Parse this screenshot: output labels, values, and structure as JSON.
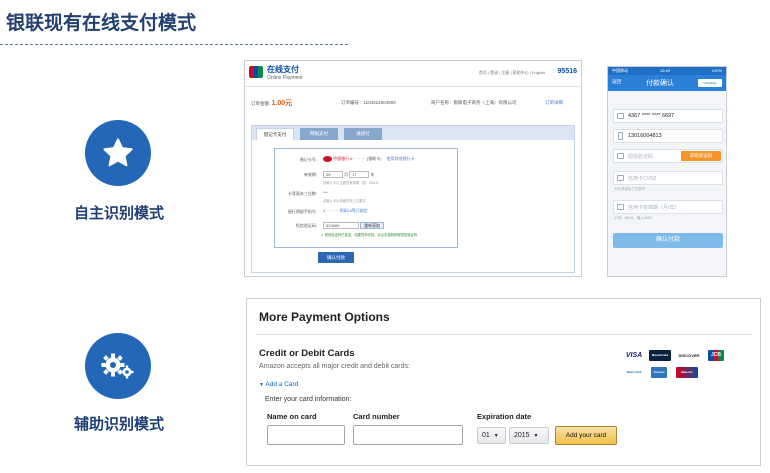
{
  "slide": {
    "title": "银联现有在线支付模式",
    "mode1_label": "自主识别模式",
    "mode2_label": "辅助识别模式"
  },
  "colors": {
    "title": "#24406e",
    "icon_blue": "#2467b6",
    "unionpay_blue": "#0a4ea2",
    "amazon_button": "#f0c14b"
  },
  "icons": {
    "mode1": "star-icon",
    "mode2": "gears-icon"
  },
  "desktop": {
    "brand": "在线支付",
    "brand_sub": "Online Payment",
    "top_links": "首页 | 登录 | 注册 | 帮助中心 | English",
    "hotline": "95516",
    "order_amount_label": "订单金额:",
    "order_amount": "1.00元",
    "order_no": "订单编号：1104221004900",
    "merchant": "商户名称：银联电子商务（上海）有限公司",
    "order_detail": "订单详细",
    "tabs": [
      "借记卡支付",
      "网银支付",
      "通道付"
    ],
    "card_no_label": "借记卡号:",
    "card_no_value": "6",
    "card_bank": "(银联卡)",
    "card_change": "使用其他银行卡",
    "expiry_label": "有效期:",
    "expiry_month": "05",
    "expiry_month_unit": "月",
    "expiry_year": "17",
    "expiry_year_unit": "年",
    "expiry_hint": "请输入卡片正面的有效期（如：08/15）",
    "cvn_label": "卡背面末三位数:",
    "cvn_value": "***",
    "cvn_hint": "请输入卡片背面的末三位数字",
    "phone_label": "银行预留手机号:",
    "phone_value": "1",
    "phone_hint": "例如15等已绑定",
    "sms_label": "短信验证码:",
    "sms_value": "523689",
    "sms_button": "重新获取",
    "sms_status": "短信验证码已发送，如果您未收到，请点击重新获取短信验证码",
    "confirm_button": "确认付款"
  },
  "mobile": {
    "status_left": "中国移动",
    "status_time": "15:49",
    "status_battery": "100%",
    "back": "返回",
    "title": "付款确认",
    "logo": "UnionPay",
    "card_no": "4367 **** **** 6697",
    "phone": "13016004813",
    "sms_placeholder": "短信验证码",
    "sms_button": "获取验证码",
    "cvn_placeholder": "信用卡CVN2",
    "cvn_hint": "卡片背面后三位数字",
    "expiry_placeholder": "信用卡有效期（月/年）",
    "expiry_hint": "示例：08/15，输入0815",
    "confirm_button": "确认付款"
  },
  "amazon": {
    "title": "More Payment Options",
    "section_title": "Credit or Debit Cards",
    "accept_text": "Amazon accepts all major credit and debit cards:",
    "add_card_link": "Add a Card",
    "enter_info": "Enter your card information:",
    "name_label": "Name on card",
    "number_label": "Card number",
    "expiry_label": "Expiration date",
    "month_value": "01",
    "year_value": "2015",
    "add_button": "Add your card",
    "card_logos": [
      "VISA",
      "MasterCard",
      "DISCOVER",
      "JCB",
      "Diners Club",
      "American Express",
      "Maestro"
    ]
  }
}
